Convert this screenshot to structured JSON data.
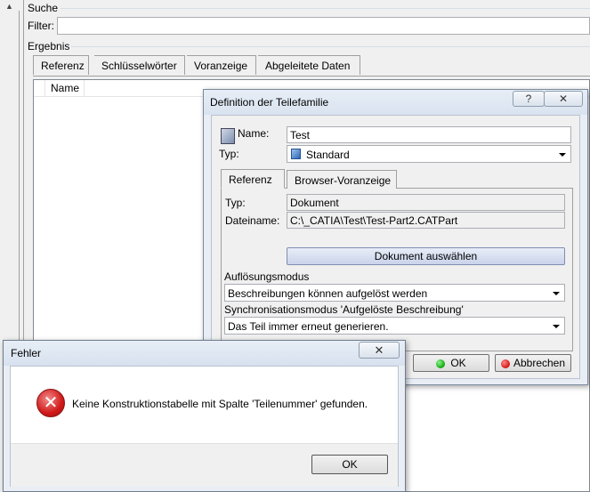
{
  "main": {
    "search_label": "Suche",
    "filter_label": "Filter:",
    "filter_value": "",
    "result_label": "Ergebnis",
    "tabs": [
      {
        "label": "Referenz"
      },
      {
        "label": "Schlüsselwörter"
      },
      {
        "label": "Voranzeige"
      },
      {
        "label": "Abgeleitete Daten"
      }
    ],
    "column_name": "Name"
  },
  "definition_dialog": {
    "title": "Definition der Teilefamilie",
    "help_button": "?",
    "close_button": "✕",
    "name_label": "Name:",
    "name_value": "Test",
    "type_label": "Typ:",
    "type_value": "Standard",
    "tabs": [
      {
        "label": "Referenz"
      },
      {
        "label": "Browser-Voranzeige"
      }
    ],
    "ref_type_label": "Typ:",
    "ref_type_value": "Dokument",
    "filename_label": "Dateiname:",
    "filename_value": "C:\\_CATIA\\Test\\Test-Part2.CATPart",
    "select_document_button": "Dokument auswählen",
    "resolution_mode_label": "Auflösungsmodus",
    "resolution_mode_value": "Beschreibungen können aufgelöst werden",
    "sync_mode_label": "Synchronisationsmodus 'Aufgelöste Beschreibung'",
    "sync_mode_value": "Das Teil immer erneut generieren.",
    "ok_button": "OK",
    "cancel_button": "Abbrechen"
  },
  "error_dialog": {
    "title": "Fehler",
    "close_button": "✕",
    "message": "Keine Konstruktionstabelle mit Spalte 'Teilenummer' gefunden.",
    "ok_button": "OK"
  },
  "colors": {
    "ok_dot": "#1db31d",
    "cancel_dot": "#e02020",
    "error_icon": "#d11919"
  }
}
